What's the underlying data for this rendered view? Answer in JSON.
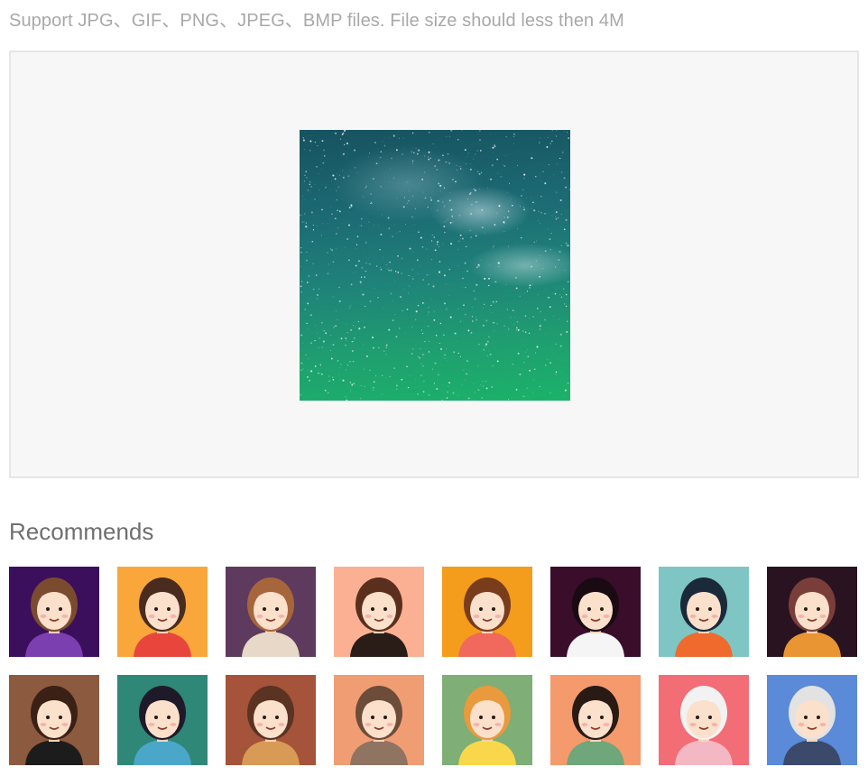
{
  "upload": {
    "hint": "Support JPG、GIF、PNG、JPEG、BMP files. File size should less then 4M",
    "preview_image": "milky-way-preview"
  },
  "recommends": {
    "title": "Recommends",
    "avatars": [
      {
        "bg": "#3c0f5c",
        "hair": "#7a4b2e",
        "shirt": "#7c3fb0"
      },
      {
        "bg": "#f9a73b",
        "hair": "#4a2c1e",
        "shirt": "#e8463c"
      },
      {
        "bg": "#5e3b5e",
        "hair": "#a7653c",
        "shirt": "#e7d8c8"
      },
      {
        "bg": "#fbb093",
        "hair": "#5a2f1d",
        "shirt": "#2a1d18"
      },
      {
        "bg": "#f49c1c",
        "hair": "#7a3d1c",
        "shirt": "#f0695c"
      },
      {
        "bg": "#3a0d2b",
        "hair": "#1a0a12",
        "shirt": "#f5f5f5"
      },
      {
        "bg": "#7ec5c4",
        "hair": "#1b2a3a",
        "shirt": "#f06a2e"
      },
      {
        "bg": "#2a1320",
        "hair": "#7a3e3a",
        "shirt": "#e99533"
      },
      {
        "bg": "#8c5a3e",
        "hair": "#3b2015",
        "shirt": "#1c1c1c"
      },
      {
        "bg": "#2f8778",
        "hair": "#1f1a2a",
        "shirt": "#4ba7c9"
      },
      {
        "bg": "#a5533a",
        "hair": "#5a3322",
        "shirt": "#d89b55"
      },
      {
        "bg": "#f19d74",
        "hair": "#6e4c3a",
        "shirt": "#8f7462"
      },
      {
        "bg": "#7fae76",
        "hair": "#e89a3c",
        "shirt": "#f8d84a"
      },
      {
        "bg": "#f59a6c",
        "hair": "#2a1a14",
        "shirt": "#6fa77a"
      },
      {
        "bg": "#f26d76",
        "hair": "#f2f2f2",
        "shirt": "#f4b7c4"
      },
      {
        "bg": "#5a8ad8",
        "hair": "#e2e2e2",
        "shirt": "#3b4a6a"
      }
    ]
  }
}
